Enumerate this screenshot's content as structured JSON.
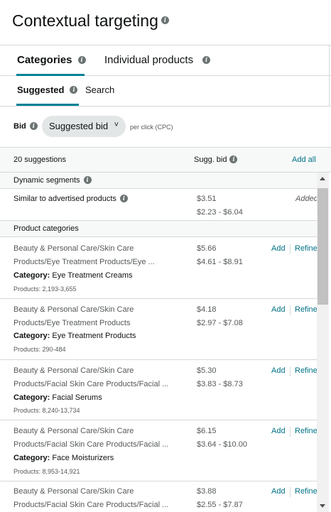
{
  "header": {
    "title": "Contextual targeting"
  },
  "tabs": [
    {
      "label": "Categories",
      "active": true
    },
    {
      "label": "Individual products",
      "active": false
    }
  ],
  "subtabs": [
    {
      "label": "Suggested",
      "active": true
    },
    {
      "label": "Search",
      "active": false
    }
  ],
  "bid": {
    "label": "Bid",
    "selected": "Suggested bid",
    "unit": "per click (CPC)"
  },
  "table": {
    "count_label": "20 suggestions",
    "bid_header": "Sugg. bid",
    "add_all": "Add all"
  },
  "dynamic": {
    "section_label": "Dynamic segments",
    "row": {
      "label": "Similar to advertised products",
      "bid": "$3.51",
      "range": "$2.23 - $6.04",
      "status": "Added"
    }
  },
  "categories": {
    "section_label": "Product categories",
    "category_prefix": "Category:",
    "add_label": "Add",
    "refine_label": "Refine",
    "items": [
      {
        "path1": "Beauty & Personal Care/Skin Care",
        "path2": "Products/Eye Treatment Products/Eye ...",
        "category": "Eye Treatment Creams",
        "products": "Products: 2,193-3,655",
        "bid": "$5.66",
        "range": "$4.61 - $8.91"
      },
      {
        "path1": "Beauty & Personal Care/Skin Care",
        "path2": "Products/Eye Treatment Products",
        "category": "Eye Treatment Products",
        "products": "Products: 290-484",
        "bid": "$4.18",
        "range": "$2.97 - $7.08"
      },
      {
        "path1": "Beauty & Personal Care/Skin Care",
        "path2": "Products/Facial Skin Care Products/Facial ...",
        "category": "Facial Serums",
        "products": "Products: 8,240-13,734",
        "bid": "$5.30",
        "range": "$3.83 - $8.73"
      },
      {
        "path1": "Beauty & Personal Care/Skin Care",
        "path2": "Products/Facial Skin Care Products/Facial ...",
        "category": "Face Moisturizers",
        "products": "Products: 8,953-14,921",
        "bid": "$6.15",
        "range": "$3.64 - $10.00"
      },
      {
        "path1": "Beauty & Personal Care/Skin Care",
        "path2": "Products/Facial Skin Care Products/Facial ...",
        "category": "",
        "products": "",
        "bid": "$3.88",
        "range": "$2.55 - $7.87"
      }
    ]
  }
}
